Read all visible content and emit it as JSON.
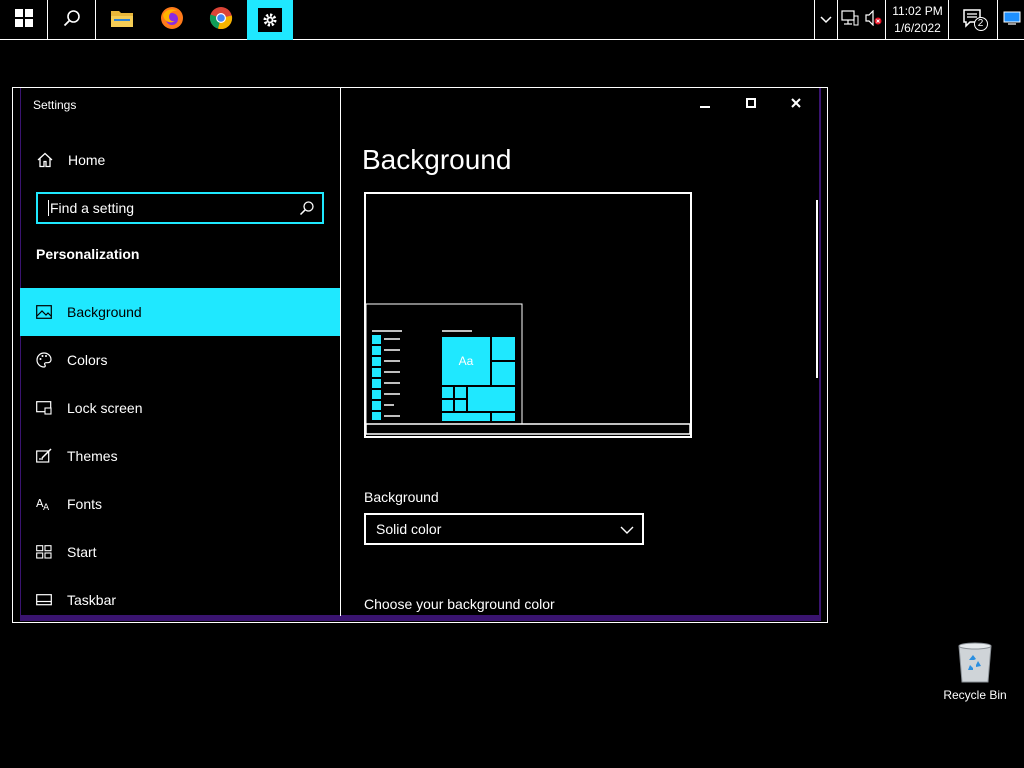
{
  "taskbar": {
    "apps": [
      {
        "name": "start",
        "icon": "windows-logo-icon"
      },
      {
        "name": "search",
        "icon": "search-icon"
      },
      {
        "name": "file-explorer",
        "icon": "folder-icon"
      },
      {
        "name": "firefox",
        "icon": "firefox-icon"
      },
      {
        "name": "chrome",
        "icon": "chrome-icon"
      },
      {
        "name": "settings",
        "icon": "gear-icon",
        "active": true
      }
    ],
    "clock": {
      "time": "11:02 PM",
      "date": "1/6/2022"
    },
    "notifications_count": "2"
  },
  "window": {
    "title": "Settings",
    "home_label": "Home",
    "search_placeholder": "Find a setting",
    "section_title": "Personalization",
    "nav_items": [
      {
        "label": "Background",
        "icon": "picture-icon",
        "selected": true
      },
      {
        "label": "Colors",
        "icon": "palette-icon"
      },
      {
        "label": "Lock screen",
        "icon": "lock-screen-icon"
      },
      {
        "label": "Themes",
        "icon": "themes-icon"
      },
      {
        "label": "Fonts",
        "icon": "fonts-icon"
      },
      {
        "label": "Start",
        "icon": "start-icon"
      },
      {
        "label": "Taskbar",
        "icon": "taskbar-icon"
      }
    ]
  },
  "content": {
    "page_title": "Background",
    "preview_tile_text": "Aa",
    "background_label": "Background",
    "background_value": "Solid color",
    "choose_color_label": "Choose your background color"
  },
  "desktop": {
    "recycle_bin_label": "Recycle Bin"
  },
  "colors": {
    "accent": "#1fe8ff",
    "window_frame": "#3a1470",
    "background": "#000000"
  }
}
